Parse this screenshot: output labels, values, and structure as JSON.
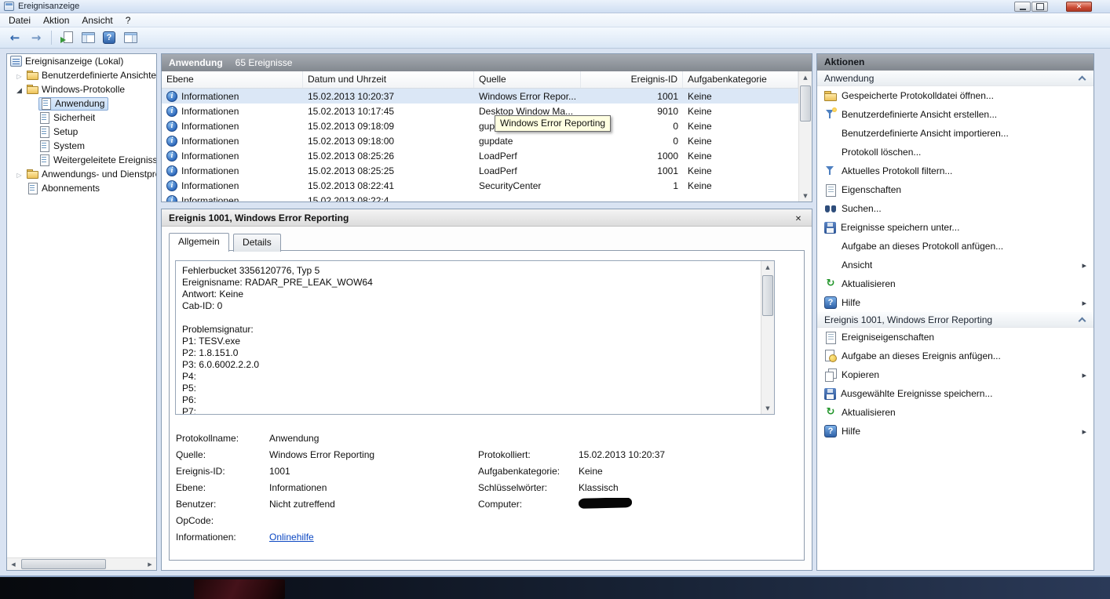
{
  "colors": {
    "titlebar": "#d7e3f4",
    "close_button": "#c94a33",
    "selection_blue": "#dbe7f6",
    "tooltip_bg": "#ffffe1",
    "link": "#0b47c2",
    "header_gray": "#82888f"
  },
  "window": {
    "title": "Ereignisanzeige",
    "controls": [
      "minimize-icon",
      "maximize-icon",
      "close-icon"
    ]
  },
  "menubar": {
    "items": [
      "Datei",
      "Aktion",
      "Ansicht",
      "?"
    ]
  },
  "toolbar": {
    "icons": [
      "back-icon",
      "forward-icon",
      "export-list-icon",
      "console-tree-icon",
      "help-icon",
      "action-pane-icon"
    ]
  },
  "tree": {
    "items": [
      {
        "label": "Ereignisanzeige (Lokal)",
        "icon": "event-viewer-icon"
      },
      {
        "label": "Benutzerdefinierte Ansichten",
        "icon": "folder-icon",
        "state": "collapsed"
      },
      {
        "label": "Windows-Protokolle",
        "icon": "folder-icon",
        "state": "expanded"
      },
      {
        "label": "Anwendung",
        "icon": "log-icon",
        "selected": true
      },
      {
        "label": "Sicherheit",
        "icon": "log-icon"
      },
      {
        "label": "Setup",
        "icon": "log-icon"
      },
      {
        "label": "System",
        "icon": "log-icon"
      },
      {
        "label": "Weitergeleitete Ereignisse",
        "icon": "log-icon"
      },
      {
        "label": "Anwendungs- und Dienstprotokolle",
        "icon": "folder-icon",
        "state": "collapsed"
      },
      {
        "label": "Abonnements",
        "icon": "log-icon"
      }
    ]
  },
  "eventlist": {
    "title": "Anwendung",
    "count": "65 Ereignisse",
    "columns": [
      "Ebene",
      "Datum und Uhrzeit",
      "Quelle",
      "Ereignis-ID",
      "Aufgabenkategorie"
    ],
    "rows": [
      {
        "level": "Informationen",
        "datetime": "15.02.2013 10:20:37",
        "source": "Windows Error Repor...",
        "event_id": "1001",
        "category": "Keine"
      },
      {
        "level": "Informationen",
        "datetime": "15.02.2013 10:17:45",
        "source": "Desktop Window Ma...",
        "event_id": "9010",
        "category": "Keine"
      },
      {
        "level": "Informationen",
        "datetime": "15.02.2013 09:18:09",
        "source": "gupdate",
        "event_id": "0",
        "category": "Keine"
      },
      {
        "level": "Informationen",
        "datetime": "15.02.2013 09:18:00",
        "source": "gupdate",
        "event_id": "0",
        "category": "Keine"
      },
      {
        "level": "Informationen",
        "datetime": "15.02.2013 08:25:26",
        "source": "LoadPerf",
        "event_id": "1000",
        "category": "Keine"
      },
      {
        "level": "Informationen",
        "datetime": "15.02.2013 08:25:25",
        "source": "LoadPerf",
        "event_id": "1001",
        "category": "Keine"
      },
      {
        "level": "Informationen",
        "datetime": "15.02.2013 08:22:41",
        "source": "SecurityCenter",
        "event_id": "1",
        "category": "Keine"
      }
    ],
    "partial_row": {
      "level": "Informationen",
      "datetime": "15.02.2013 08:22:4"
    },
    "tooltip": "Windows Error Reporting"
  },
  "detail": {
    "title": "Ereignis 1001, Windows Error Reporting",
    "tabs": [
      "Allgemein",
      "Details"
    ],
    "message": "Fehlerbucket 3356120776, Typ 5\nEreignisname: RADAR_PRE_LEAK_WOW64\nAntwort: Keine\nCab-ID: 0\n\nProblemsignatur:\nP1: TESV.exe\nP2: 1.8.151.0\nP3: 6.0.6002.2.2.0\nP4:\nP5:\nP6:\nP7:",
    "fields": {
      "log_name_label": "Protokollname:",
      "log_name": "Anwendung",
      "source_label": "Quelle:",
      "source": "Windows Error Reporting",
      "logged_label": "Protokolliert:",
      "logged": "15.02.2013 10:20:37",
      "event_id_label": "Ereignis-ID:",
      "event_id": "1001",
      "category_label": "Aufgabenkategorie:",
      "category": "Keine",
      "level_label": "Ebene:",
      "level": "Informationen",
      "keywords_label": "Schlüsselwörter:",
      "keywords": "Klassisch",
      "user_label": "Benutzer:",
      "user": "Nicht zutreffend",
      "computer_label": "Computer:",
      "opcode_label": "OpCode:",
      "info_label": "Informationen:",
      "info_link": "Onlinehilfe"
    }
  },
  "actions": {
    "title": "Aktionen",
    "sections": [
      {
        "title": "Anwendung",
        "items": [
          {
            "label": "Gespeicherte Protokolldatei öffnen...",
            "icon": "folder-open-icon"
          },
          {
            "label": "Benutzerdefinierte Ansicht erstellen...",
            "icon": "create-custom-view-icon"
          },
          {
            "label": "Benutzerdefinierte Ansicht importieren...",
            "icon": null
          },
          {
            "label": "Protokoll löschen...",
            "icon": null
          },
          {
            "label": "Aktuelles Protokoll filtern...",
            "icon": "filter-icon"
          },
          {
            "label": "Eigenschaften",
            "icon": "properties-icon"
          },
          {
            "label": "Suchen...",
            "icon": "search-icon"
          },
          {
            "label": "Ereignisse speichern unter...",
            "icon": "save-icon"
          },
          {
            "label": "Aufgabe an dieses Protokoll anfügen...",
            "icon": null
          },
          {
            "label": "Ansicht",
            "icon": null,
            "submenu": true
          },
          {
            "label": "Aktualisieren",
            "icon": "refresh-icon"
          },
          {
            "label": "Hilfe",
            "icon": "help-icon",
            "submenu": true
          }
        ]
      },
      {
        "title": "Ereignis 1001, Windows Error Reporting",
        "items": [
          {
            "label": "Ereigniseigenschaften",
            "icon": "event-properties-icon"
          },
          {
            "label": "Aufgabe an dieses Ereignis anfügen...",
            "icon": "attach-task-icon"
          },
          {
            "label": "Kopieren",
            "icon": "copy-icon",
            "submenu": true
          },
          {
            "label": "Ausgewählte Ereignisse speichern...",
            "icon": "save-icon"
          },
          {
            "label": "Aktualisieren",
            "icon": "refresh-icon"
          },
          {
            "label": "Hilfe",
            "icon": "help-icon",
            "submenu": true
          }
        ]
      }
    ]
  }
}
